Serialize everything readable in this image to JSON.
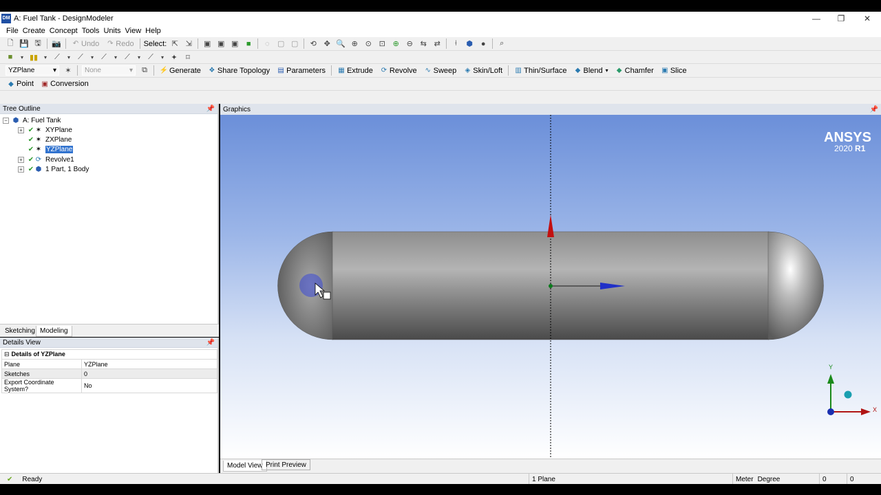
{
  "window": {
    "title": "A: Fuel Tank - DesignModeler",
    "app_icon_text": "DM"
  },
  "menu": [
    "File",
    "Create",
    "Concept",
    "Tools",
    "Units",
    "View",
    "Help"
  ],
  "toolbar1": {
    "undo": "Undo",
    "redo": "Redo",
    "select_label": "Select:"
  },
  "toolbar3": {
    "plane_combo": "YZPlane",
    "sketch_combo": "None",
    "buttons": [
      "Generate",
      "Share Topology",
      "Parameters",
      "Extrude",
      "Revolve",
      "Sweep",
      "Skin/Loft",
      "Thin/Surface",
      "Blend",
      "Chamfer",
      "Slice"
    ]
  },
  "toolbar4": {
    "buttons": [
      "Point",
      "Conversion"
    ]
  },
  "tree": {
    "header": "Tree Outline",
    "root": "A: Fuel Tank",
    "items": [
      "XYPlane",
      "ZXPlane",
      "YZPlane",
      "Revolve1",
      "1 Part, 1 Body"
    ]
  },
  "left_tabs": [
    "Sketching",
    "Modeling"
  ],
  "details": {
    "header": "Details View",
    "title": "Details of YZPlane",
    "rows": [
      {
        "label": "Plane",
        "value": "YZPlane"
      },
      {
        "label": "Sketches",
        "value": "0"
      },
      {
        "label": "Export Coordinate System?",
        "value": "No"
      }
    ]
  },
  "graphics": {
    "header": "Graphics",
    "brand": "ANSYS",
    "version_prefix": "2020",
    "version_suffix": "R1",
    "axis_y": "Y",
    "axis_x": "X"
  },
  "graphics_tabs": [
    "Model View",
    "Print Preview"
  ],
  "status": {
    "state": "Ready",
    "selection": "1 Plane",
    "unit_length": "Meter",
    "unit_angle": "Degree",
    "coord1": "0",
    "coord2": "0"
  }
}
